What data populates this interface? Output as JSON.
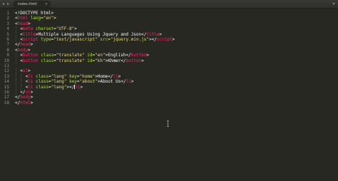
{
  "editor": {
    "nav_back_glyph": "◂",
    "nav_forward_glyph": "▸",
    "tab_title": "index.html",
    "tab_close_glyph": "×",
    "overflow_glyph": "▾"
  },
  "lines": [
    {
      "num": "1",
      "indent": 0,
      "tokens": [
        {
          "t": "<!DOCTYPE html>",
          "c": "plain"
        }
      ]
    },
    {
      "num": "2",
      "indent": 0,
      "tokens": [
        {
          "t": "<",
          "c": "plain"
        },
        {
          "t": "html",
          "c": "tag"
        },
        {
          "t": " ",
          "c": "plain"
        },
        {
          "t": "lang",
          "c": "attr"
        },
        {
          "t": "=",
          "c": "plain"
        },
        {
          "t": "\"en\"",
          "c": "str"
        },
        {
          "t": ">",
          "c": "plain"
        }
      ]
    },
    {
      "num": "3",
      "indent": 0,
      "tokens": [
        {
          "t": "<",
          "c": "plain"
        },
        {
          "t": "head",
          "c": "tag"
        },
        {
          "t": ">",
          "c": "plain"
        }
      ]
    },
    {
      "num": "4",
      "indent": 1,
      "tokens": [
        {
          "t": "<",
          "c": "plain"
        },
        {
          "t": "meta",
          "c": "tag"
        },
        {
          "t": " ",
          "c": "plain"
        },
        {
          "t": "charset",
          "c": "attr"
        },
        {
          "t": "=",
          "c": "plain"
        },
        {
          "t": "\"UTF-8\"",
          "c": "str"
        },
        {
          "t": ">",
          "c": "plain"
        }
      ]
    },
    {
      "num": "5",
      "indent": 1,
      "tokens": [
        {
          "t": "<",
          "c": "plain"
        },
        {
          "t": "title",
          "c": "tag"
        },
        {
          "t": ">Multiple Languages Using Jquery and Json</",
          "c": "plain"
        },
        {
          "t": "title",
          "c": "tag"
        },
        {
          "t": ">",
          "c": "plain"
        }
      ]
    },
    {
      "num": "6",
      "indent": 1,
      "tokens": [
        {
          "t": "<",
          "c": "plain"
        },
        {
          "t": "script",
          "c": "tag"
        },
        {
          "t": " ",
          "c": "plain"
        },
        {
          "t": "type",
          "c": "attr"
        },
        {
          "t": "=",
          "c": "plain"
        },
        {
          "t": "\"text/javascript\"",
          "c": "str"
        },
        {
          "t": " ",
          "c": "plain"
        },
        {
          "t": "src",
          "c": "attr"
        },
        {
          "t": "=",
          "c": "plain"
        },
        {
          "t": "\"jquery.min.js\"",
          "c": "str"
        },
        {
          "t": "></",
          "c": "plain"
        },
        {
          "t": "script",
          "c": "tag"
        },
        {
          "t": ">",
          "c": "plain"
        }
      ]
    },
    {
      "num": "7",
      "indent": 0,
      "tokens": [
        {
          "t": "</",
          "c": "plain"
        },
        {
          "t": "head",
          "c": "tag"
        },
        {
          "t": ">",
          "c": "plain"
        }
      ]
    },
    {
      "num": "8",
      "indent": 0,
      "tokens": [
        {
          "t": "<",
          "c": "plain"
        },
        {
          "t": "body",
          "c": "tag"
        },
        {
          "t": ">",
          "c": "plain"
        }
      ]
    },
    {
      "num": "9",
      "indent": 1,
      "tokens": [
        {
          "t": "<",
          "c": "plain"
        },
        {
          "t": "button",
          "c": "tag"
        },
        {
          "t": " ",
          "c": "plain"
        },
        {
          "t": "class",
          "c": "attr"
        },
        {
          "t": "=",
          "c": "plain"
        },
        {
          "t": "\"translate\"",
          "c": "str"
        },
        {
          "t": " ",
          "c": "plain"
        },
        {
          "t": "id",
          "c": "attr"
        },
        {
          "t": "=",
          "c": "plain"
        },
        {
          "t": "\"en\"",
          "c": "str"
        },
        {
          "t": ">English</",
          "c": "plain"
        },
        {
          "t": "button",
          "c": "tag"
        },
        {
          "t": ">",
          "c": "plain"
        }
      ]
    },
    {
      "num": "10",
      "indent": 1,
      "tokens": [
        {
          "t": "<",
          "c": "plain"
        },
        {
          "t": "button",
          "c": "tag"
        },
        {
          "t": " ",
          "c": "plain"
        },
        {
          "t": "class",
          "c": "attr"
        },
        {
          "t": "=",
          "c": "plain"
        },
        {
          "t": "\"translate\"",
          "c": "str"
        },
        {
          "t": " ",
          "c": "plain"
        },
        {
          "t": "id",
          "c": "attr"
        },
        {
          "t": "=",
          "c": "plain"
        },
        {
          "t": "\"kh\"",
          "c": "str"
        },
        {
          "t": ">Khmer</",
          "c": "plain"
        },
        {
          "t": "button",
          "c": "tag"
        },
        {
          "t": ">",
          "c": "plain"
        }
      ]
    },
    {
      "num": "11",
      "indent": 0,
      "tokens": []
    },
    {
      "num": "12",
      "indent": 1,
      "tokens": [
        {
          "t": "<",
          "c": "plain"
        },
        {
          "t": "ul",
          "c": "tag"
        },
        {
          "t": ">",
          "c": "plain"
        }
      ]
    },
    {
      "num": "13",
      "indent": 2,
      "tokens": [
        {
          "t": "<",
          "c": "plain"
        },
        {
          "t": "li",
          "c": "tag"
        },
        {
          "t": " ",
          "c": "plain"
        },
        {
          "t": "class",
          "c": "attr"
        },
        {
          "t": "=",
          "c": "plain"
        },
        {
          "t": "\"lang\"",
          "c": "str"
        },
        {
          "t": " ",
          "c": "plain"
        },
        {
          "t": "key",
          "c": "attr"
        },
        {
          "t": "=",
          "c": "plain"
        },
        {
          "t": "\"home\"",
          "c": "str"
        },
        {
          "t": ">Home</",
          "c": "plain"
        },
        {
          "t": "li",
          "c": "tag"
        },
        {
          "t": ">",
          "c": "plain"
        }
      ]
    },
    {
      "num": "14",
      "indent": 2,
      "tokens": [
        {
          "t": "<",
          "c": "plain"
        },
        {
          "t": "li",
          "c": "tag"
        },
        {
          "t": " ",
          "c": "plain"
        },
        {
          "t": "class",
          "c": "attr"
        },
        {
          "t": "=",
          "c": "plain"
        },
        {
          "t": "\"lang\"",
          "c": "str"
        },
        {
          "t": " ",
          "c": "plain"
        },
        {
          "t": "key",
          "c": "attr"
        },
        {
          "t": "=",
          "c": "plain"
        },
        {
          "t": "\"about\"",
          "c": "str"
        },
        {
          "t": ">About Us</",
          "c": "plain"
        },
        {
          "t": "li",
          "c": "tag"
        },
        {
          "t": ">",
          "c": "plain"
        }
      ]
    },
    {
      "num": "15",
      "indent": 2,
      "tokens": [
        {
          "t": "<",
          "c": "plain"
        },
        {
          "t": "li",
          "c": "tag"
        },
        {
          "t": " ",
          "c": "plain"
        },
        {
          "t": "class",
          "c": "attr"
        },
        {
          "t": "=",
          "c": "plain"
        },
        {
          "t": "\"lang\"",
          "c": "str"
        },
        {
          "t": ">",
          "c": "plain"
        },
        {
          "t": "</",
          "c": "plain"
        },
        {
          "t": "li",
          "c": "tag"
        },
        {
          "t": ">",
          "c": "plain"
        }
      ]
    },
    {
      "num": "16",
      "indent": 1,
      "tokens": [
        {
          "t": "</",
          "c": "plain"
        },
        {
          "t": "ul",
          "c": "tag"
        },
        {
          "t": ">",
          "c": "plain"
        }
      ]
    },
    {
      "num": "17",
      "indent": 0,
      "tokens": [
        {
          "t": "</",
          "c": "plain"
        },
        {
          "t": "body",
          "c": "tag"
        },
        {
          "t": ">",
          "c": "plain"
        }
      ]
    },
    {
      "num": "18",
      "indent": 0,
      "tokens": [
        {
          "t": "</",
          "c": "plain"
        },
        {
          "t": "html",
          "c": "tag"
        },
        {
          "t": ">",
          "c": "plain"
        }
      ]
    }
  ],
  "cursor": {
    "line": "15",
    "after_token": 7
  },
  "colors": {
    "background": "#282823",
    "tag": "#f92672",
    "attribute": "#a6e22e",
    "string": "#e6db74",
    "text": "#f8f8f2",
    "gutter_text": "#8f908a"
  }
}
